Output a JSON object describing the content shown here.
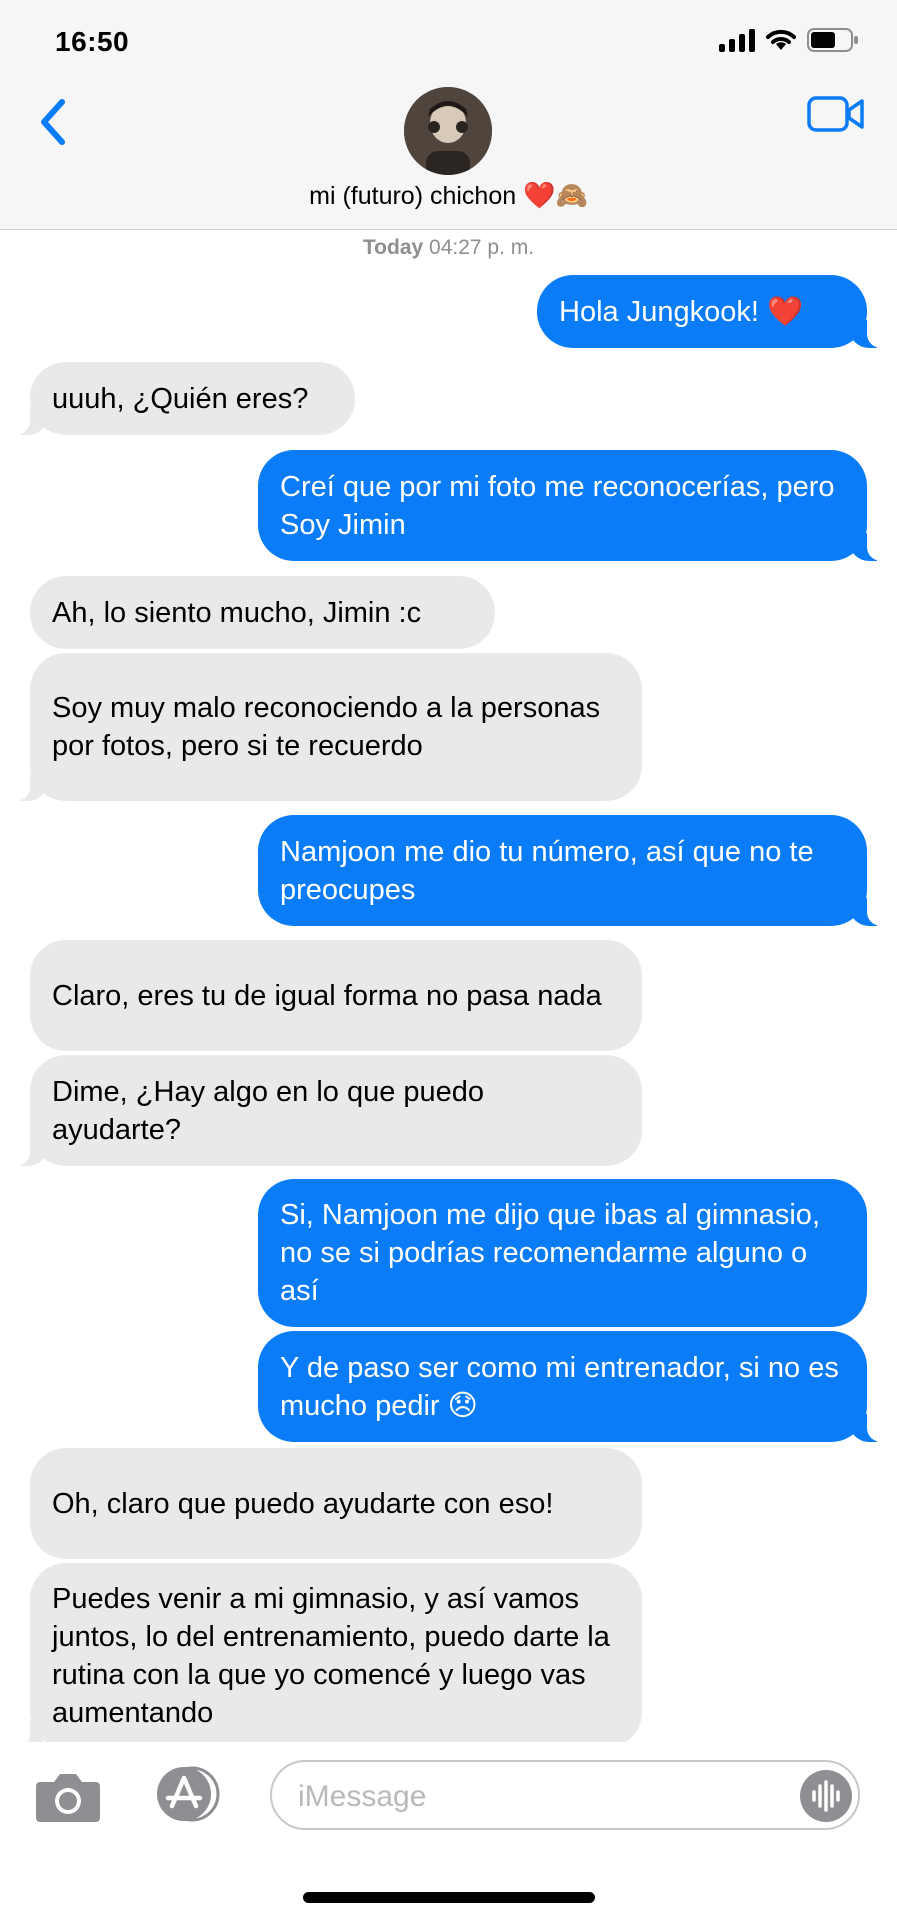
{
  "status_bar": {
    "time": "16:50"
  },
  "header": {
    "contact_name": "mi (futuro) chichon",
    "contact_emoji": "❤️🙈",
    "back_icon": "chevron-left-icon",
    "video_icon": "video-camera-icon"
  },
  "conversation": {
    "timestamp_day": "Today",
    "timestamp_time": "04:27 p. m.",
    "messages": [
      {
        "direction": "out",
        "text": "Hola Jungkook! ❤️"
      },
      {
        "direction": "in",
        "text": "uuuh, ¿Quién eres?"
      },
      {
        "direction": "out",
        "text": "Creí que por mi foto me reconocerías, pero Soy Jimin"
      },
      {
        "direction": "in",
        "text": "Ah, lo siento mucho, Jimin :c"
      },
      {
        "direction": "in",
        "text": "Soy muy malo reconociendo a la personas por fotos, pero si te recuerdo"
      },
      {
        "direction": "out",
        "text": "Namjoon me dio tu número, así que no te preocupes"
      },
      {
        "direction": "in",
        "text": "Claro, eres tu de igual forma no pasa nada"
      },
      {
        "direction": "in",
        "text": "Dime, ¿Hay algo en lo que puedo ayudarte?"
      },
      {
        "direction": "out",
        "text": "Si, Namjoon me dijo que ibas al gimnasio, no se si podrías recomendarme alguno o así"
      },
      {
        "direction": "out",
        "text": "Y de paso ser como mi entrenador, si no es mucho pedir 😞"
      },
      {
        "direction": "in",
        "text": "Oh, claro que puedo ayudarte con eso!"
      },
      {
        "direction": "in",
        "text": "Puedes venir a mi gimnasio, y así vamos juntos, lo del entrenamiento, puedo darte la rutina con la que yo comencé y luego vas aumentando"
      }
    ]
  },
  "compose": {
    "placeholder": "iMessage",
    "value": "",
    "camera_icon": "camera-icon",
    "apps_icon": "app-store-icon",
    "audio_icon": "audio-waveform-icon"
  },
  "colors": {
    "outgoing": "#0a7cf7",
    "incoming": "#e9e9eb",
    "accent": "#0a7cf7"
  }
}
